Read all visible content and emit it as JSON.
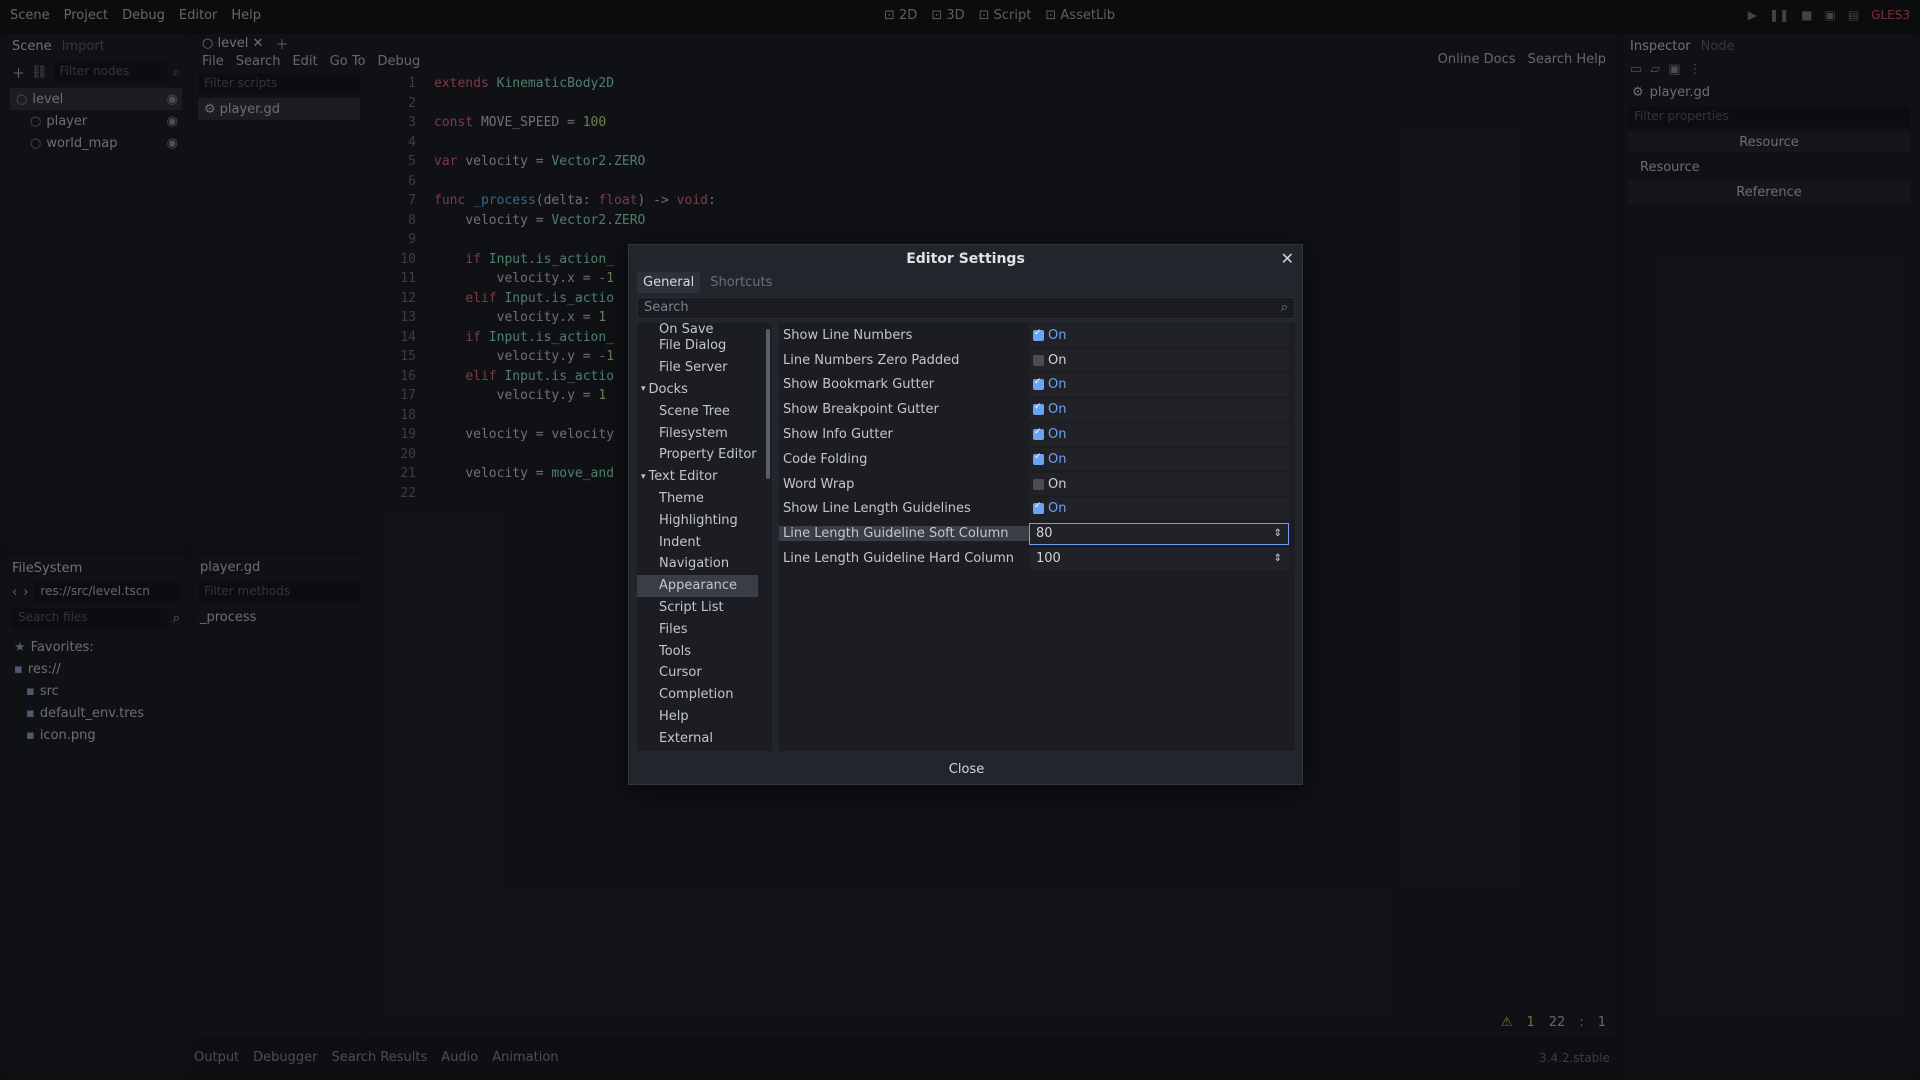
{
  "menu": [
    "Scene",
    "Project",
    "Debug",
    "Editor",
    "Help"
  ],
  "modes": [
    {
      "label": "2D",
      "icon": "2d-icon",
      "active": false
    },
    {
      "label": "3D",
      "icon": "3d-icon",
      "active": false
    },
    {
      "label": "Script",
      "icon": "script-icon",
      "active": true
    },
    {
      "label": "AssetLib",
      "icon": "assetlib-icon",
      "active": false
    }
  ],
  "renderer": "GLES3",
  "scene_dock": {
    "tabs": [
      "Scene",
      "Import"
    ],
    "filter_placeholder": "Filter nodes",
    "nodes": [
      {
        "label": "level",
        "indent": 0,
        "selected": true
      },
      {
        "label": "player",
        "indent": 1,
        "selected": false
      },
      {
        "label": "world_map",
        "indent": 1,
        "selected": false
      }
    ]
  },
  "filesystem": {
    "title": "FileSystem",
    "path": "res://src/level.tscn",
    "search_placeholder": "Search files",
    "items": [
      {
        "label": "Favorites:",
        "icon": "star-icon"
      },
      {
        "label": "res://",
        "icon": "folder-icon"
      },
      {
        "label": "src",
        "icon": "folder-icon"
      },
      {
        "label": "default_env.tres",
        "icon": "resource-icon"
      },
      {
        "label": "icon.png",
        "icon": "image-icon"
      }
    ]
  },
  "script_editor": {
    "tab": "level",
    "menu": [
      "File",
      "Search",
      "Edit",
      "Go To",
      "Debug"
    ],
    "right_links": [
      "Online Docs",
      "Search Help"
    ],
    "filter_scripts_placeholder": "Filter scripts",
    "scripts": [
      "player.gd"
    ],
    "methods_title": "player.gd",
    "filter_methods_placeholder": "Filter methods",
    "methods": [
      "_process"
    ],
    "status": {
      "warnings": "1",
      "line": "22",
      "sep": ":",
      "col": "1"
    },
    "lines": [
      "extends KinematicBody2D",
      "",
      "const MOVE_SPEED = 100",
      "",
      "var velocity = Vector2.ZERO",
      "",
      "func _process(delta: float) -> void:",
      "    velocity = Vector2.ZERO",
      "",
      "    if Input.is_action_",
      "        velocity.x = -1",
      "    elif Input.is_actio",
      "        velocity.x = 1",
      "    if Input.is_action_",
      "        velocity.y = -1",
      "    elif Input.is_actio",
      "        velocity.y = 1",
      "",
      "    velocity = velocity",
      "",
      "    velocity = move_and",
      ""
    ]
  },
  "inspector": {
    "tabs": [
      "Inspector",
      "Node"
    ],
    "object": "player.gd",
    "filter_placeholder": "Filter properties",
    "sections": [
      "Resource",
      "Resource",
      "Reference"
    ]
  },
  "bottom_tabs": [
    "Output",
    "Debugger",
    "Search Results",
    "Audio",
    "Animation"
  ],
  "version": "3.4.2.stable",
  "dialog": {
    "title": "Editor Settings",
    "tabs": [
      "General",
      "Shortcuts"
    ],
    "search_placeholder": "Search",
    "categories": [
      {
        "label": "On Save",
        "group": false,
        "selected": false
      },
      {
        "label": "File Dialog",
        "group": false,
        "selected": false
      },
      {
        "label": "File Server",
        "group": false,
        "selected": false
      },
      {
        "label": "Docks",
        "group": true,
        "selected": false
      },
      {
        "label": "Scene Tree",
        "group": false,
        "selected": false
      },
      {
        "label": "Filesystem",
        "group": false,
        "selected": false
      },
      {
        "label": "Property Editor",
        "group": false,
        "selected": false
      },
      {
        "label": "Text Editor",
        "group": true,
        "selected": false
      },
      {
        "label": "Theme",
        "group": false,
        "selected": false
      },
      {
        "label": "Highlighting",
        "group": false,
        "selected": false
      },
      {
        "label": "Indent",
        "group": false,
        "selected": false
      },
      {
        "label": "Navigation",
        "group": false,
        "selected": false
      },
      {
        "label": "Appearance",
        "group": false,
        "selected": true
      },
      {
        "label": "Script List",
        "group": false,
        "selected": false
      },
      {
        "label": "Files",
        "group": false,
        "selected": false
      },
      {
        "label": "Tools",
        "group": false,
        "selected": false
      },
      {
        "label": "Cursor",
        "group": false,
        "selected": false
      },
      {
        "label": "Completion",
        "group": false,
        "selected": false
      },
      {
        "label": "Help",
        "group": false,
        "selected": false
      },
      {
        "label": "External",
        "group": false,
        "selected": false
      }
    ],
    "settings": [
      {
        "label": "Show Line Numbers",
        "type": "bool",
        "checked": true,
        "value": "On"
      },
      {
        "label": "Line Numbers Zero Padded",
        "type": "bool",
        "checked": false,
        "value": "On"
      },
      {
        "label": "Show Bookmark Gutter",
        "type": "bool",
        "checked": true,
        "value": "On"
      },
      {
        "label": "Show Breakpoint Gutter",
        "type": "bool",
        "checked": true,
        "value": "On"
      },
      {
        "label": "Show Info Gutter",
        "type": "bool",
        "checked": true,
        "value": "On"
      },
      {
        "label": "Code Folding",
        "type": "bool",
        "checked": true,
        "value": "On"
      },
      {
        "label": "Word Wrap",
        "type": "bool",
        "checked": false,
        "value": "On"
      },
      {
        "label": "Show Line Length Guidelines",
        "type": "bool",
        "checked": true,
        "value": "On"
      },
      {
        "label": "Line Length Guideline Soft Column",
        "type": "int",
        "value": "80",
        "selected": true
      },
      {
        "label": "Line Length Guideline Hard Column",
        "type": "int",
        "value": "100",
        "selected": false
      }
    ],
    "close_label": "Close"
  }
}
